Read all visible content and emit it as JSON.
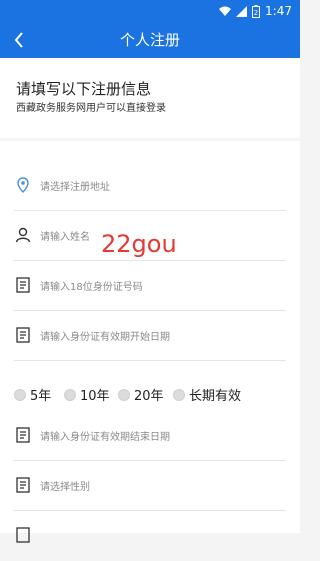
{
  "status_bar": {
    "time": "1:47",
    "battery_level": "2"
  },
  "app_bar": {
    "title": "个人注册"
  },
  "header": {
    "title": "请填写以下注册信息",
    "subtitle": "西藏政务服务网用户可以直接登录"
  },
  "form": {
    "address": {
      "placeholder": "请选择注册地址",
      "icon": "location-pin-icon"
    },
    "name": {
      "placeholder": "请输入姓名",
      "icon": "user-icon"
    },
    "id_number": {
      "placeholder": "请输入18位身份证号码",
      "icon": "id-card-icon"
    },
    "id_start": {
      "placeholder": "请输入身份证有效期开始日期",
      "icon": "id-card-icon"
    },
    "validity_options": [
      "5年",
      "10年",
      "20年",
      "长期有效"
    ],
    "id_end": {
      "placeholder": "请输入身份证有效期结束日期",
      "icon": "id-card-icon"
    },
    "gender": {
      "placeholder": "请选择性别",
      "icon": "id-card-icon"
    }
  },
  "watermark": "22gou",
  "colors": {
    "primary": "#1a73e0",
    "watermark": "#e53935"
  }
}
